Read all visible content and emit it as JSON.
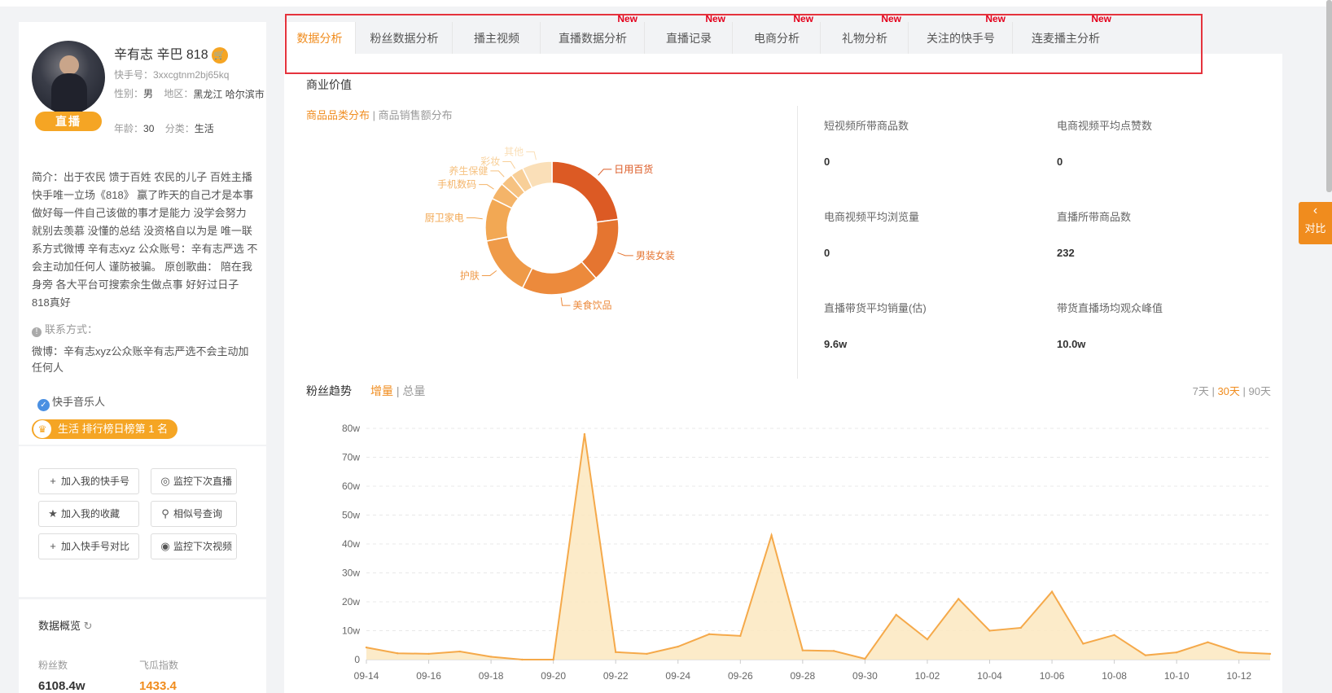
{
  "profile": {
    "name": "辛有志 辛巴 818",
    "cart_icon": "cart-icon",
    "live_badge": "直播",
    "kuaishou_id": "快手号：3xxcgtnm2bj65kq",
    "gender_label": "性别：",
    "gender": "男",
    "region_label": "地区：",
    "region": "黑龙江 哈尔滨市",
    "age_label": "年龄：",
    "age": "30",
    "category_label": "分类：",
    "category": "生活",
    "intro": "简介：出于农民 馈于百姓 农民的儿子 百姓主播 快手唯一立场《818》 赢了昨天的自己才是本事 做好每一件自己该做的事才是能力 没学会努力 就别去羡慕 没懂的总结 没资格自以为是 唯一联系方式微博 辛有志xyz 公众账号：辛有志严选 不会主动加任何人 谨防被骗。 原创歌曲： 陪在我身旁 各大平台可搜索余生做点事 好好过日子 818真好",
    "contact_label": "联系方式：",
    "contact": "微博：辛有志xyz公众账辛有志严选不会主动加任何人",
    "verify": "快手音乐人",
    "rank": "生活 排行榜日榜第 1 名"
  },
  "actions": {
    "add_account": "加入我的快手号",
    "monitor_live": "监控下次直播",
    "add_favorite": "加入我的收藏",
    "similar": "相似号查询",
    "add_compare": "加入快手号对比",
    "monitor_video": "监控下次视频"
  },
  "overview": {
    "title": "数据概览",
    "fans_label": "粉丝数",
    "fans": "6108.4w",
    "index_label": "飞瓜指数",
    "index": "1433.4"
  },
  "tabs": [
    {
      "label": "数据分析",
      "new": ""
    },
    {
      "label": "粉丝数据分析",
      "new": ""
    },
    {
      "label": "播主视频",
      "new": ""
    },
    {
      "label": "直播数据分析",
      "new": "New"
    },
    {
      "label": "直播记录",
      "new": "New"
    },
    {
      "label": "电商分析",
      "new": "New"
    },
    {
      "label": "礼物分析",
      "new": "New"
    },
    {
      "label": "关注的快手号",
      "new": "New"
    },
    {
      "label": "连麦播主分析",
      "new": "New"
    }
  ],
  "commerce": {
    "title": "商业价值",
    "switch_on": "商品品类分布",
    "switch_sep": " | ",
    "switch_off": "商品销售额分布"
  },
  "stats": [
    {
      "label": "短视频所带商品数",
      "value": "0"
    },
    {
      "label": "电商视频平均点赞数",
      "value": "0"
    },
    {
      "label": "电商视频平均浏览量",
      "value": "0"
    },
    {
      "label": "直播所带商品数",
      "value": "232"
    },
    {
      "label": "直播带货平均销量(估)",
      "value": "9.6w"
    },
    {
      "label": "带货直播场均观众峰值",
      "value": "10.0w"
    }
  ],
  "trend": {
    "title": "粉丝趋势",
    "inc": "增量",
    "sep": " | ",
    "total": "总量",
    "r7": "7天",
    "r30": "30天",
    "r90": "90天"
  },
  "side": {
    "label": "对比",
    "icon": "chevron-left-icon"
  },
  "colors": {
    "accent": "#f08c1e",
    "new": "#e4001b",
    "line": "#f5a94a",
    "fill": "#fbe7c0"
  },
  "chart_data": [
    {
      "type": "pie",
      "subtype": "donut",
      "categories": [
        "日用百货",
        "男装女装",
        "美食饮品",
        "护肤",
        "厨卫家电",
        "手机数码",
        "养生保健",
        "彩妆",
        "其他"
      ],
      "values": [
        22,
        15,
        18,
        14,
        10,
        4,
        3,
        3,
        7
      ],
      "colors": [
        "#dc5a24",
        "#e57530",
        "#ec8a3c",
        "#ef9a48",
        "#f2a854",
        "#f4b469",
        "#f6c281",
        "#f8cf98",
        "#fadfb8"
      ]
    },
    {
      "type": "area",
      "title": "粉丝趋势",
      "x": [
        "09-14",
        "09-15",
        "09-16",
        "09-17",
        "09-18",
        "09-19",
        "09-20",
        "09-21",
        "09-22",
        "09-23",
        "09-24",
        "09-25",
        "09-26",
        "09-27",
        "09-28",
        "09-29",
        "09-30",
        "10-01",
        "10-02",
        "10-03",
        "10-04",
        "10-05",
        "10-06",
        "10-07",
        "10-08",
        "10-09",
        "10-10",
        "10-11",
        "10-12",
        "10-13"
      ],
      "x_ticks": [
        "09-14",
        "09-16",
        "09-18",
        "09-20",
        "09-22",
        "09-24",
        "09-26",
        "09-28",
        "09-30",
        "10-02",
        "10-04",
        "10-06",
        "10-08",
        "10-10",
        "10-12"
      ],
      "series": [
        {
          "values": [
            4.2,
            2.2,
            2.0,
            2.8,
            1.0,
            0,
            0,
            78,
            2.6,
            2.0,
            4.5,
            8.8,
            8.2,
            43,
            3.2,
            3.0,
            0.3,
            15.5,
            7.0,
            21,
            10,
            11,
            23.5,
            5.5,
            8.5,
            1.5,
            2.5,
            6,
            2.5,
            2.0
          ]
        }
      ],
      "y_ticks": [
        "0",
        "10w",
        "20w",
        "30w",
        "40w",
        "50w",
        "60w",
        "70w",
        "80w"
      ],
      "ylim": [
        0,
        80
      ],
      "grid": true
    }
  ]
}
